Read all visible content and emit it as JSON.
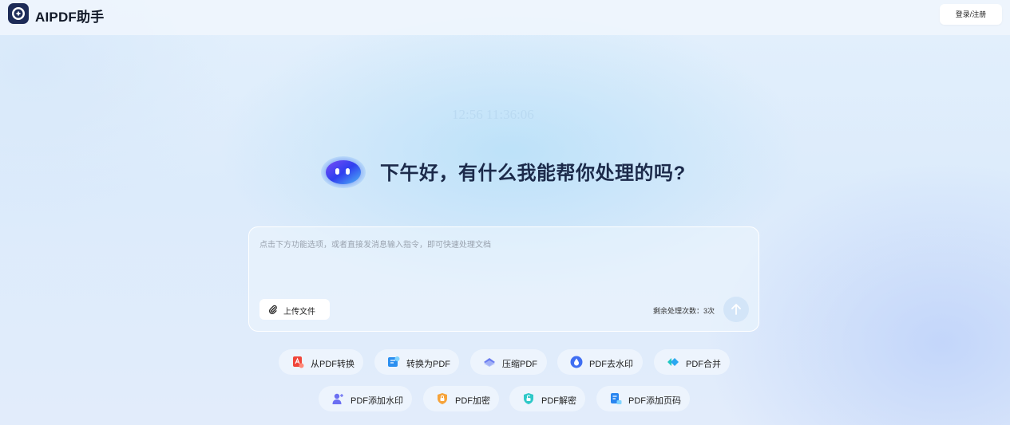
{
  "app": {
    "brand": "AIPDF助手",
    "login_label": "登录/注册"
  },
  "hero": {
    "time_text": "12:56 11:36:06",
    "greeting": "下午好，有什么我能帮你处理的吗?"
  },
  "composer": {
    "placeholder": "点击下方功能选项，或者直接发消息输入指令，即可快速处理文档",
    "upload_label": "上传文件",
    "remaining_label": "剩余处理次数：3次",
    "remaining_count": 3
  },
  "tools": [
    {
      "label": "从PDF转换",
      "icon": "pdf-convert-from-icon",
      "color": "#f0453a"
    },
    {
      "label": "转换为PDF",
      "icon": "convert-to-pdf-icon",
      "color": "#2b8ff0"
    },
    {
      "label": "压缩PDF",
      "icon": "compress-pdf-icon",
      "color": "#6a7cf0"
    },
    {
      "label": "PDF去水印",
      "icon": "remove-watermark-icon",
      "color": "#3f6ef2"
    },
    {
      "label": "PDF合并",
      "icon": "merge-pdf-icon",
      "color": "#1fc7c2"
    },
    {
      "label": "PDF添加水印",
      "icon": "add-watermark-icon",
      "color": "#6b6ff2"
    },
    {
      "label": "PDF加密",
      "icon": "encrypt-pdf-icon",
      "color": "#f6a33a"
    },
    {
      "label": "PDF解密",
      "icon": "decrypt-pdf-icon",
      "color": "#2ec8c8"
    },
    {
      "label": "PDF添加页码",
      "icon": "add-page-number-icon",
      "color": "#2a86f0"
    }
  ],
  "colors": {
    "brand_dark": "#1c2a4a",
    "accent": "#2b8ff0",
    "send_disabled": "#d3e5f8"
  }
}
